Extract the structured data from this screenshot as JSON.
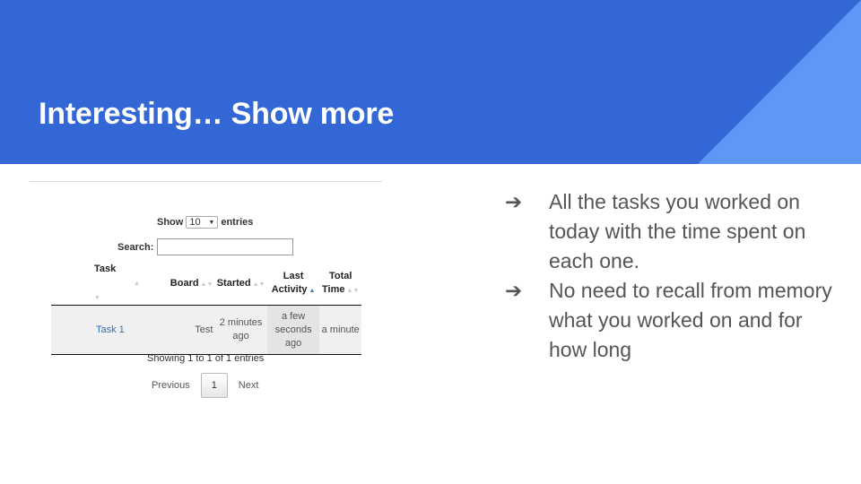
{
  "slide": {
    "title": "Interesting… Show more",
    "colors": {
      "header": "#3367d6",
      "accent_triangle": "#5e97f6",
      "text": "#555555"
    }
  },
  "widget": {
    "show_label": "Show",
    "page_size": "10",
    "entries_label": "entries",
    "search_label": "Search:",
    "search_value": "",
    "columns": [
      "Task",
      "Board",
      "Started",
      "Last Activity",
      "Total Time"
    ],
    "row": {
      "task": "Task 1",
      "board": "Test",
      "started": "2 minutes ago",
      "last_activity": "a few seconds ago",
      "total_time": "a minute"
    },
    "info": "Showing 1 to 1 of 1 entries",
    "pagination": {
      "previous": "Previous",
      "current_page": "1",
      "next": "Next"
    }
  },
  "bullets": {
    "marker": "➔",
    "items": [
      "All the tasks you worked on today with the time spent on each one.",
      "No need to recall from memory  what you worked on and for how long"
    ]
  }
}
